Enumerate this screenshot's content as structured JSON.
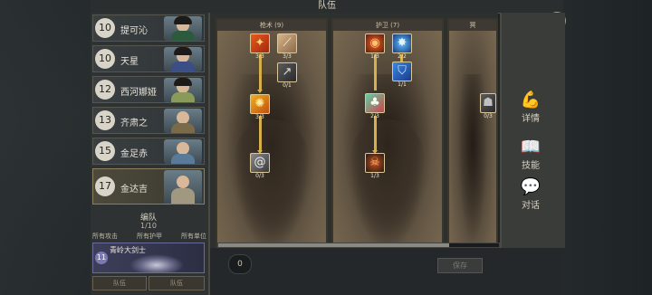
{
  "header": {
    "title": "队伍",
    "close_icon": "×"
  },
  "roster": {
    "heroes": [
      {
        "level": "10",
        "name": "提可沁"
      },
      {
        "level": "10",
        "name": "天星"
      },
      {
        "level": "12",
        "name": "西河娜娅"
      },
      {
        "level": "13",
        "name": "齐肃之"
      },
      {
        "level": "15",
        "name": "金足赤"
      },
      {
        "level": "17",
        "name": "金达吉"
      }
    ],
    "team_title": "编队",
    "team_count": "1/10",
    "filters": [
      "所有攻击",
      "所有护甲",
      "所有单位"
    ],
    "unit": {
      "level": "11",
      "name": "青岭大剑士"
    },
    "buttons": [
      "队伍",
      "队伍"
    ]
  },
  "columns": [
    {
      "header": "枪术 (9)"
    },
    {
      "header": "护卫 (7)"
    },
    {
      "header": "冥"
    }
  ],
  "skills": {
    "c1": [
      {
        "count": "3/3",
        "icon": "fire-slash-icon"
      },
      {
        "count": "3/3",
        "icon": "claw-icon"
      },
      {
        "count": "0/1",
        "icon": "spear-icon"
      },
      {
        "count": "3/3",
        "icon": "flame-icon"
      },
      {
        "count": "0/3",
        "icon": "swirl-icon"
      }
    ],
    "c2": [
      {
        "count": "1/3",
        "icon": "flame-shield-icon"
      },
      {
        "count": "2/2",
        "icon": "blue-burst-icon"
      },
      {
        "count": "1/1",
        "icon": "blue-shield-icon"
      },
      {
        "count": "2/3",
        "icon": "green-heal-icon"
      },
      {
        "count": "1/3",
        "icon": "fire-demon-icon"
      }
    ],
    "c3": [
      {
        "count": "0/3",
        "icon": "shadow-icon"
      }
    ]
  },
  "bottom": {
    "points": "0",
    "save": "保存"
  },
  "tools": [
    {
      "label": "详情",
      "icon": "arm-icon"
    },
    {
      "label": "技能",
      "icon": "book-icon"
    },
    {
      "label": "对话",
      "icon": "chat-icon"
    }
  ]
}
